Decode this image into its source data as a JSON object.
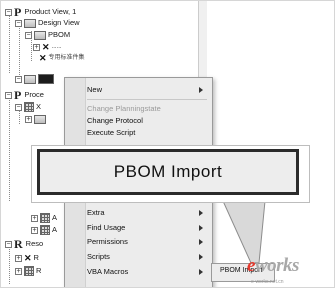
{
  "tree": {
    "nodes": [
      {
        "label": "Product View, 1"
      },
      {
        "label": "Design View"
      },
      {
        "label": "PBOM"
      },
      {
        "label": "......"
      },
      {
        "label": "专用标准件集"
      },
      {
        "label": "Proce"
      },
      {
        "label": "X"
      },
      {
        "label": "A"
      },
      {
        "label": "A"
      },
      {
        "label": "Reso"
      },
      {
        "label": "R"
      },
      {
        "label": "R"
      }
    ]
  },
  "menu": {
    "items": [
      {
        "label": "New",
        "submenu": true
      },
      {
        "label": "Change Planningstate",
        "disabled": true
      },
      {
        "label": "Change Protocol"
      },
      {
        "label": "Execute Script"
      },
      {
        "label": "Extra",
        "submenu": true
      },
      {
        "label": "Find Usage",
        "submenu": true
      },
      {
        "label": "Permissions",
        "submenu": true
      },
      {
        "label": "Scripts",
        "submenu": true
      },
      {
        "label": "VBA Macros",
        "submenu": true
      }
    ],
    "submenu_item": "PBOM Import"
  },
  "callout": {
    "label": "PBOM Import"
  },
  "watermark": {
    "brand": "works",
    "brand_first": "e",
    "subtitle": "e-works.net.cn"
  },
  "colors": {
    "watermark_red": "#e43a2e",
    "callout_border": "#2b2b2b",
    "menu_bg": "#ececec"
  }
}
